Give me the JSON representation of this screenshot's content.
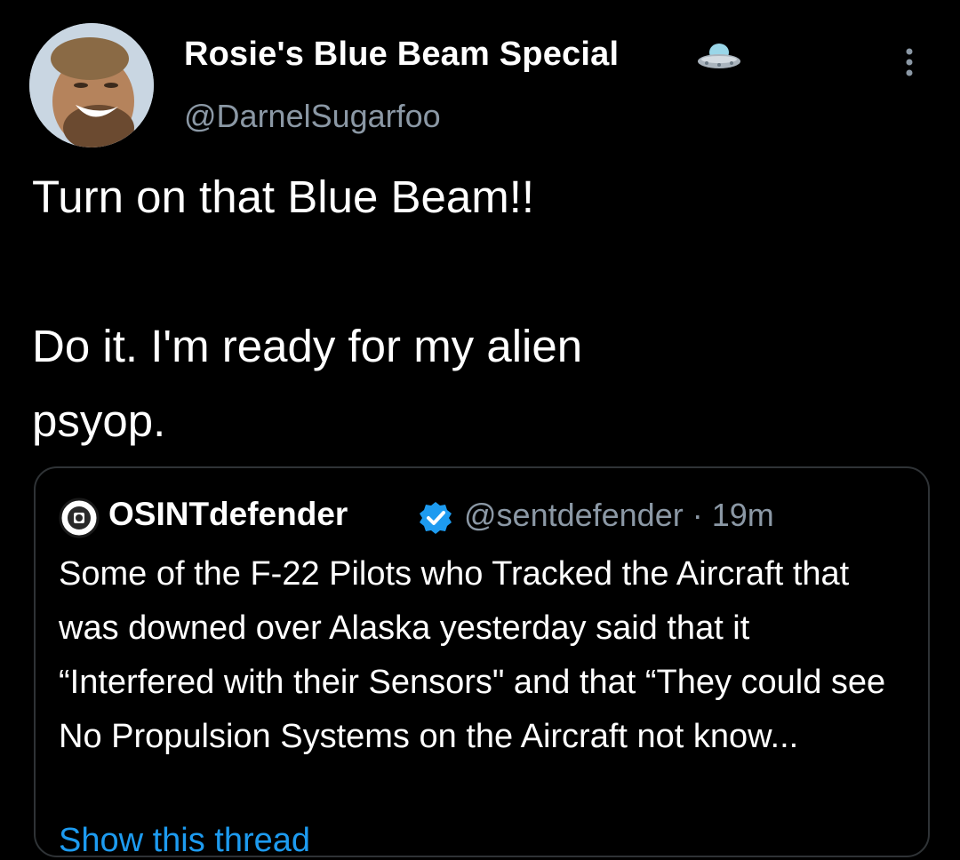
{
  "tweet": {
    "author_name": "Rosie's Blue Beam Special",
    "author_handle": "@DarnelSugarfoo",
    "author_emoji_icon": "ufo-icon",
    "text": "Turn on that Blue Beam!!\n\nDo it. I'm ready for my alien\npsyop."
  },
  "quote": {
    "author_name": "OSINTdefender",
    "verified_icon": "verified-badge-icon",
    "handle_and_time": "@sentdefender · 19m",
    "text": "Some of the F-22 Pilots who Tracked the Aircraft that was downed over Alaska yesterday said that it “Interfered with their Sensors\" and that “They could see No Propulsion Systems on the Aircraft not know...",
    "show_thread": "Show this thread"
  },
  "colors": {
    "background": "#000000",
    "primary_text": "#ffffff",
    "secondary_text": "#8b98a5",
    "border": "#2f3336",
    "accent": "#1d9bf0"
  }
}
